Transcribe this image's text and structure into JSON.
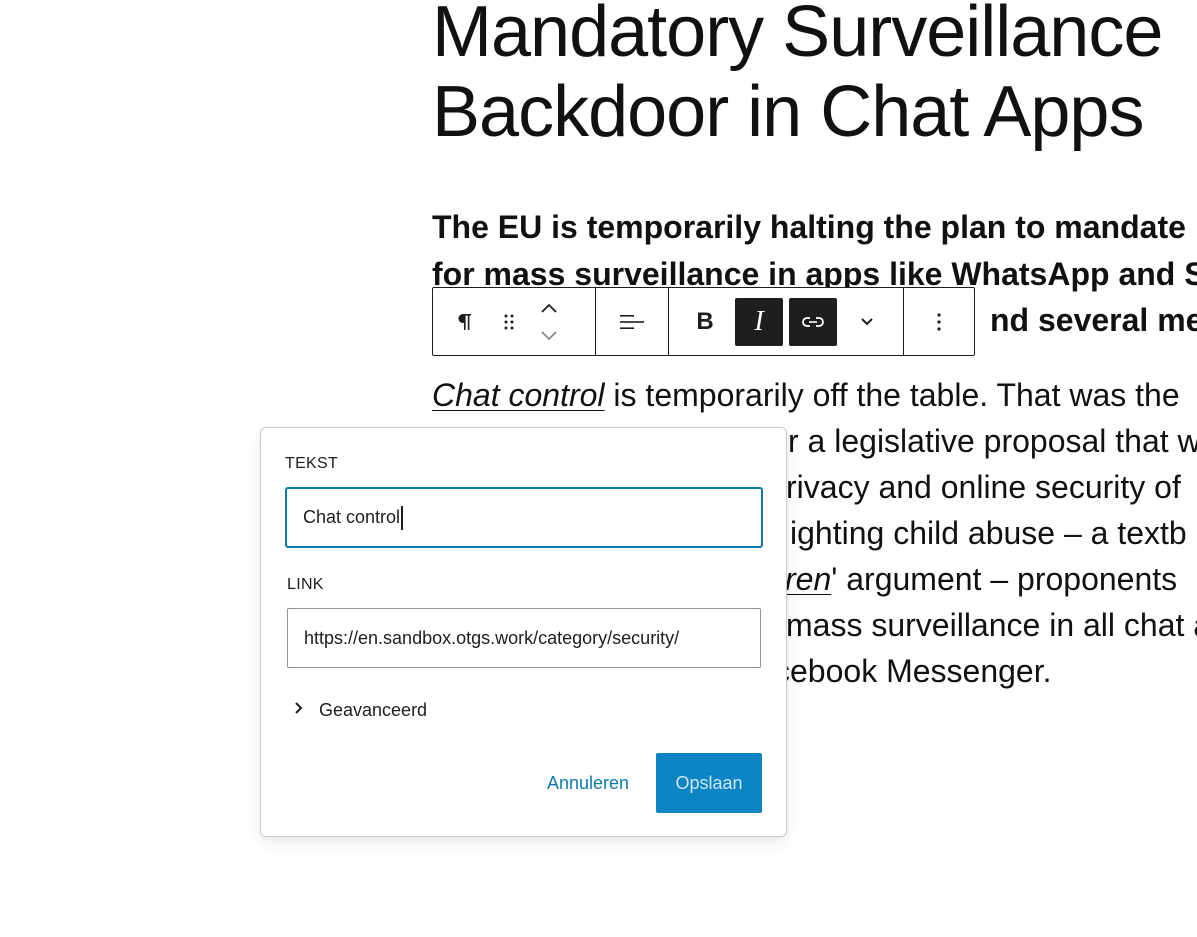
{
  "post": {
    "title_lines": [
      "Mandatory Surveillance",
      "Backdoor in Chat Apps"
    ],
    "lead_lines": [
      "The EU is temporarily halting the plan to mandate",
      "for mass surveillance in apps like WhatsApp and S",
      "",
      "nd several mer"
    ],
    "body": {
      "link_text": "Chat control",
      "line1_rest": " is temporarily off the table. That was the",
      "line2": "r a legislative proposal that w",
      "line3": "rivacy and online security of",
      "line4": "ighting child abuse – a textb",
      "line5_link": "ren",
      "line5_rest": "' argument – proponents",
      "line6": "mass surveillance in all chat a",
      "line7": "cebook Messenger."
    }
  },
  "toolbar": {
    "paragraph_icon": "pilcrow-icon",
    "drag_icon": "drag-handle-icon",
    "move_up_icon": "chevron-up-icon",
    "move_down_icon": "chevron-down-icon",
    "align_icon": "align-left-icon",
    "bold_label": "B",
    "italic_label": "I",
    "link_icon": "link-icon",
    "more_formats_icon": "chevron-down-icon",
    "options_icon": "more-vertical-icon",
    "active_color": "#1e1e1e"
  },
  "link_popover": {
    "text_label": "TEKST",
    "text_value": "Chat control",
    "link_label": "LINK",
    "link_value": "https://en.sandbox.otgs.work/category/security/",
    "advanced_label": "Geavanceerd",
    "cancel_label": "Annuleren",
    "save_label": "Opslaan",
    "accent_color": "#0a7aad",
    "save_bg_color": "#0a84c2"
  }
}
